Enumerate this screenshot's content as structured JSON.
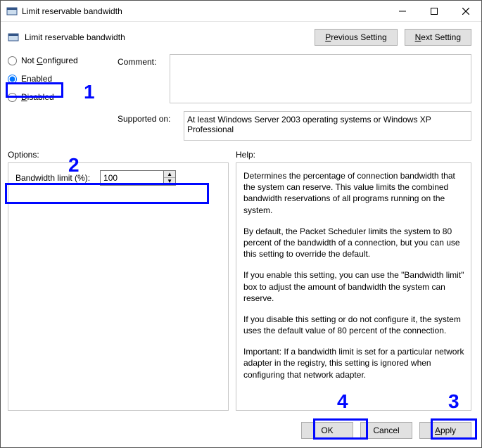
{
  "title": "Limit reservable bandwidth",
  "header_title": "Limit reservable bandwidth",
  "nav": {
    "previous": "Previous Setting",
    "next": "Next Setting"
  },
  "radios": {
    "not_configured": "Not Configured",
    "enabled": "Enabled",
    "disabled": "Disabled",
    "selected": "enabled"
  },
  "comment": {
    "label": "Comment:",
    "value": ""
  },
  "supported": {
    "label": "Supported on:",
    "value": "At least Windows Server 2003 operating systems or Windows XP Professional"
  },
  "options_label": "Options:",
  "help_label": "Help:",
  "bandwidth": {
    "label": "Bandwidth limit (%):",
    "value": "100"
  },
  "help_paragraphs": [
    "Determines the percentage of connection bandwidth that the system can reserve. This value limits the combined bandwidth reservations of all programs running on the system.",
    "By default, the Packet Scheduler limits the system to 80 percent of the bandwidth of a connection, but you can use this setting to override the default.",
    "If you enable this setting, you can use the \"Bandwidth limit\" box to adjust the amount of bandwidth the system can reserve.",
    "If you disable this setting or do not configure it, the system uses the default value of 80 percent of the connection.",
    "Important: If a bandwidth limit is set for a particular network adapter in the registry, this setting is ignored when configuring that network adapter."
  ],
  "buttons": {
    "ok": "OK",
    "cancel": "Cancel",
    "apply": "Apply"
  },
  "annotations": {
    "a1": "1",
    "a2": "2",
    "a3": "3",
    "a4": "4"
  }
}
